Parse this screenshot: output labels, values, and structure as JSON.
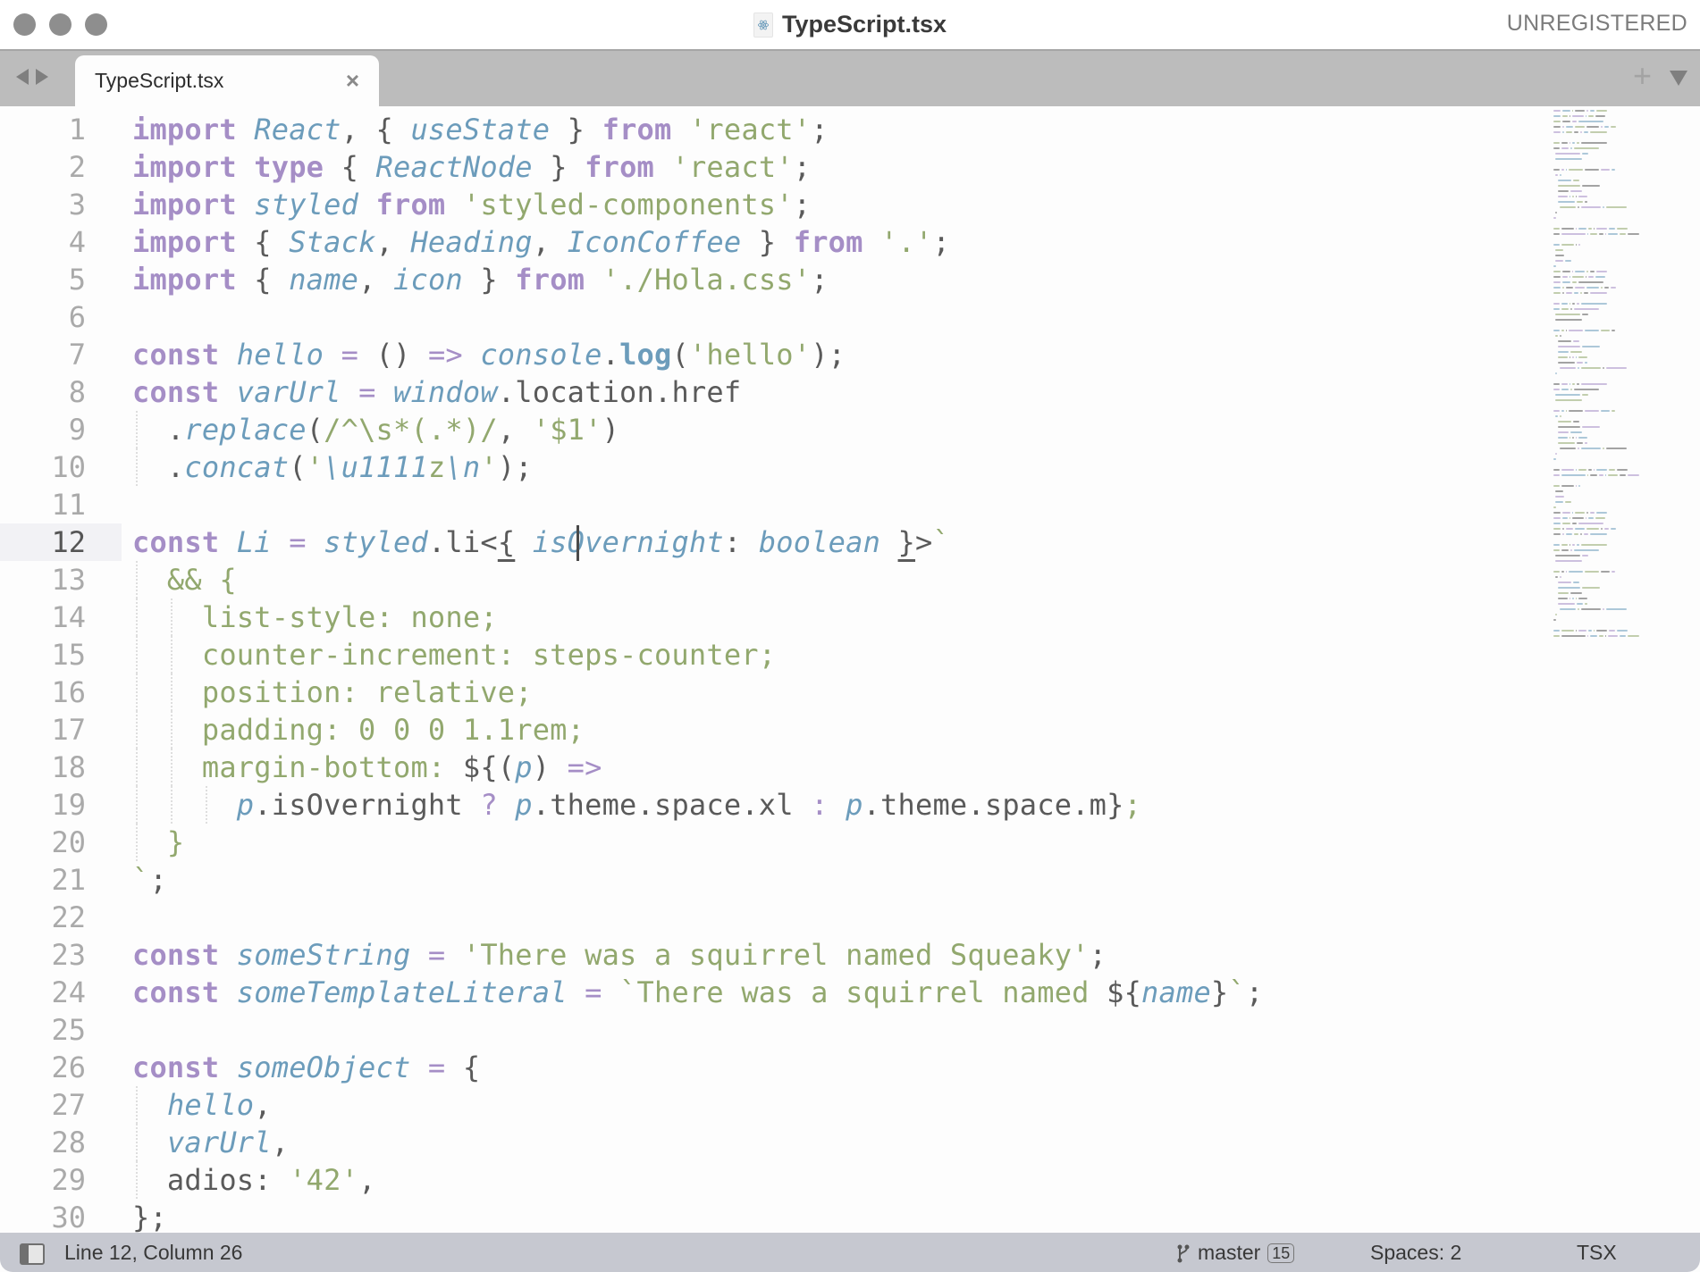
{
  "window": {
    "title": "TypeScript.tsx",
    "license_label": "UNREGISTERED",
    "file_icon": "react-atom-icon"
  },
  "tabs": [
    {
      "label": "TypeScript.tsx",
      "active": true,
      "close_icon": "close-icon"
    }
  ],
  "tabbar": {
    "new_tab_icon": "plus-icon",
    "tab_menu_icon": "triangle-down-icon"
  },
  "colors": {
    "keyword": "#a58ec6",
    "identifier": "#6c9cbb",
    "string": "#92a86e",
    "punctuation": "#5a5a5a",
    "line_number": "#aaaaaa",
    "statusbar_bg": "#c6c8d0"
  },
  "editor": {
    "current_line": 12,
    "line_numbers": [
      "1",
      "2",
      "3",
      "4",
      "5",
      "6",
      "7",
      "8",
      "9",
      "10",
      "11",
      "12",
      "13",
      "14",
      "15",
      "16",
      "17",
      "18",
      "19",
      "20",
      "21",
      "22",
      "23",
      "24",
      "25",
      "26",
      "27",
      "28",
      "29",
      "30"
    ],
    "lines": [
      "import React, { useState } from 'react';",
      "import type { ReactNode } from 'react';",
      "import styled from 'styled-components';",
      "import { Stack, Heading, IconCoffee } from '.';",
      "import { name, icon } from './Hola.css';",
      "",
      "const hello = () => console.log('hello');",
      "const varUrl = window.location.href",
      "  .replace(/^\\s*(.*)/, '$1')",
      "  .concat('\\u1111z\\n');",
      "",
      "const Li = styled.li<{ isOvernight: boolean }>`",
      "  && {",
      "    list-style: none;",
      "    counter-increment: steps-counter;",
      "    position: relative;",
      "    padding: 0 0 0 1.1rem;",
      "    margin-bottom: ${(p) =>",
      "      p.isOvernight ? p.theme.space.xl : p.theme.space.m};",
      "  }",
      "`;",
      "",
      "const someString = 'There was a squirrel named Squeaky';",
      "const someTemplateLiteral = `There was a squirrel named ${name}`;",
      "",
      "const someObject = {",
      "  hello,",
      "  varUrl,",
      "  adios: '42',",
      "};"
    ]
  },
  "statusbar": {
    "sidebar_toggle_icon": "sidebar-toggle-icon",
    "position": "Line 12, Column 26",
    "branch_icon": "git-branch-icon",
    "branch": "master",
    "branch_badge": "15",
    "indentation": "Spaces: 2",
    "syntax": "TSX"
  }
}
